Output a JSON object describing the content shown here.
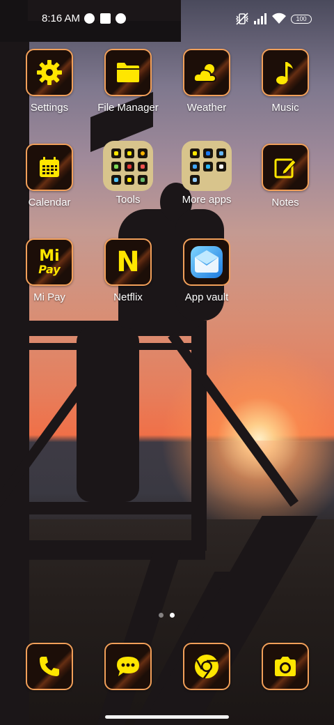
{
  "status_bar": {
    "time": "8:16 AM",
    "battery": "100",
    "icons": [
      "app-notification-icon",
      "square-notification-icon",
      "app-notification-icon",
      "vibrate-off-icon",
      "signal-icon",
      "wifi-icon"
    ]
  },
  "apps": [
    {
      "label": "Settings",
      "icon": "gear-icon"
    },
    {
      "label": "File Manager",
      "icon": "folder-icon"
    },
    {
      "label": "Weather",
      "icon": "weather-icon"
    },
    {
      "label": "Music",
      "icon": "music-note-icon"
    },
    {
      "label": "Calendar",
      "icon": "calendar-icon"
    },
    {
      "label": "Tools",
      "icon": "folder-tools-icon"
    },
    {
      "label": "More apps",
      "icon": "folder-more-apps-icon"
    },
    {
      "label": "Notes",
      "icon": "notes-pencil-icon"
    },
    {
      "label": "Mi Pay",
      "icon": "mi-pay-icon"
    },
    {
      "label": "Netflix",
      "icon": "netflix-icon"
    },
    {
      "label": "App vault",
      "icon": "app-vault-icon"
    }
  ],
  "mipay_text": {
    "top": "Mi",
    "bottom": "Pay"
  },
  "netflix_text": "N",
  "dock": [
    {
      "icon": "phone-icon"
    },
    {
      "icon": "messages-icon"
    },
    {
      "icon": "chrome-icon"
    },
    {
      "icon": "camera-icon"
    }
  ],
  "page_indicator": {
    "pages": 2,
    "current": 2
  },
  "colors": {
    "accent": "#ffe600",
    "border": "#f2a05a",
    "folder": "#d8c48c"
  }
}
